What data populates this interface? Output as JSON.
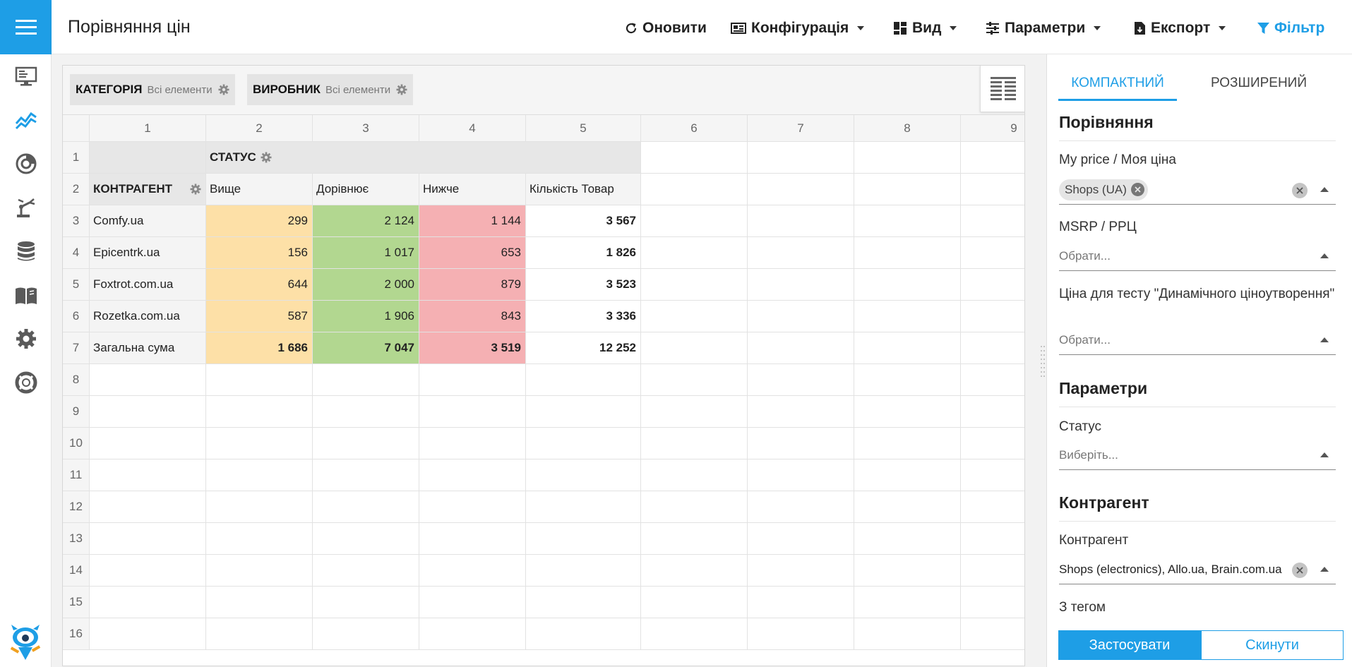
{
  "header": {
    "title": "Порівняння цін",
    "toolbar": {
      "refresh": "Оновити",
      "config": "Конфігурація",
      "view": "Вид",
      "params": "Параметри",
      "export": "Експорт",
      "filter": "Фільтр"
    }
  },
  "filters_bar": {
    "chips": [
      {
        "name": "КАТЕГОРІЯ",
        "value": "Всі елементи"
      },
      {
        "name": "ВИРОБНИК",
        "value": "Всі елементи"
      }
    ]
  },
  "grid": {
    "col_numbers": [
      "1",
      "2",
      "3",
      "4",
      "5",
      "6",
      "7",
      "8",
      "9"
    ],
    "row_numbers": [
      "1",
      "2",
      "3",
      "4",
      "5",
      "6",
      "7",
      "8",
      "9",
      "10",
      "11",
      "12",
      "13",
      "14",
      "15",
      "16"
    ],
    "column_field": "СТАТУС",
    "row_field": "КОНТРАГЕНТ",
    "columns": [
      "Вище",
      "Дорівнює",
      "Нижче",
      "Кількість Товар"
    ],
    "rows": [
      {
        "label": "Comfy.ua",
        "values": [
          "299",
          "2 124",
          "1 144",
          "3 567"
        ]
      },
      {
        "label": "Epicentrk.ua",
        "values": [
          "156",
          "1 017",
          "653",
          "1 826"
        ]
      },
      {
        "label": "Foxtrot.com.ua",
        "values": [
          "644",
          "2 000",
          "879",
          "3 523"
        ]
      },
      {
        "label": "Rozetka.com.ua",
        "values": [
          "587",
          "1 906",
          "843",
          "3 336"
        ]
      }
    ],
    "total": {
      "label": "Загальна сума",
      "values": [
        "1 686",
        "7 047",
        "3 519",
        "12 252"
      ]
    }
  },
  "panel": {
    "tabs": [
      "КОМПАКТНИЙ",
      "РОЗШИРЕНИЙ"
    ],
    "sections": {
      "compare": "Порівняння",
      "params": "Параметри",
      "counterparty": "Контрагент"
    },
    "fields": {
      "my_price_label": "My price / Моя ціна",
      "my_price_tag": "Shops (UA)",
      "msrp_label": "MSRP / РРЦ",
      "msrp_placeholder": "Обрати...",
      "dyn_label": "Ціна для тесту \"Динамічного ціноутворення\"",
      "dyn_placeholder": "Обрати...",
      "status_label": "Статус",
      "status_placeholder": "Виберіть...",
      "counterparty_label": "Контрагент",
      "counterparty_value": "Shops (electronics), Allo.ua, Brain.com.ua",
      "tag_label": "З тегом"
    },
    "apply": "Застосувати",
    "reset": "Скинути"
  },
  "colors": {
    "accent": "#1e9ee6",
    "above": "#fde0a7",
    "equal": "#b2d790",
    "below": "#f5b0b3"
  }
}
